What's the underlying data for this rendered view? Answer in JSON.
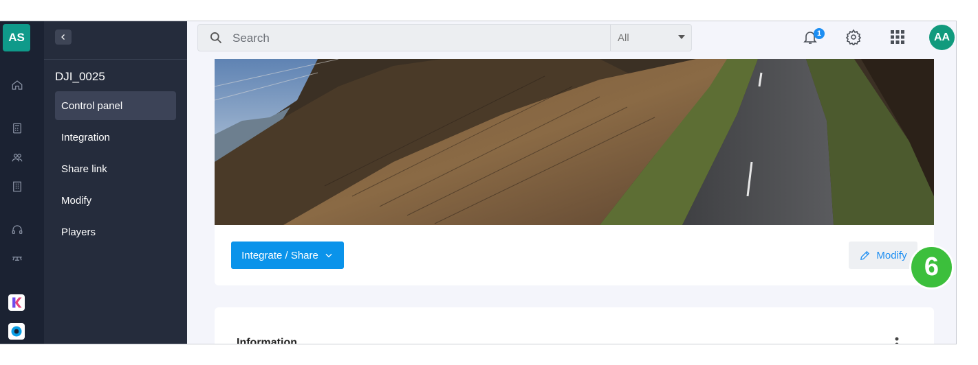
{
  "rail": {
    "avatar": "AS"
  },
  "sidebar": {
    "title": "DJI_0025",
    "items": [
      {
        "label": "Control panel",
        "active": true
      },
      {
        "label": "Integration"
      },
      {
        "label": "Share link"
      },
      {
        "label": "Modify"
      },
      {
        "label": "Players"
      }
    ]
  },
  "search": {
    "placeholder": "Search",
    "filter": "All"
  },
  "header": {
    "notification_count": "1",
    "user_initials": "AA"
  },
  "media": {
    "share_button": "Integrate / Share",
    "modify_button": "Modify",
    "step_marker": "6"
  },
  "info": {
    "title": "Information"
  },
  "colors": {
    "accent": "#0a93ea",
    "rail": "#1b2232",
    "sidebar": "#252c3c",
    "avatar": "#119a7d",
    "step": "#3cbf3c"
  }
}
